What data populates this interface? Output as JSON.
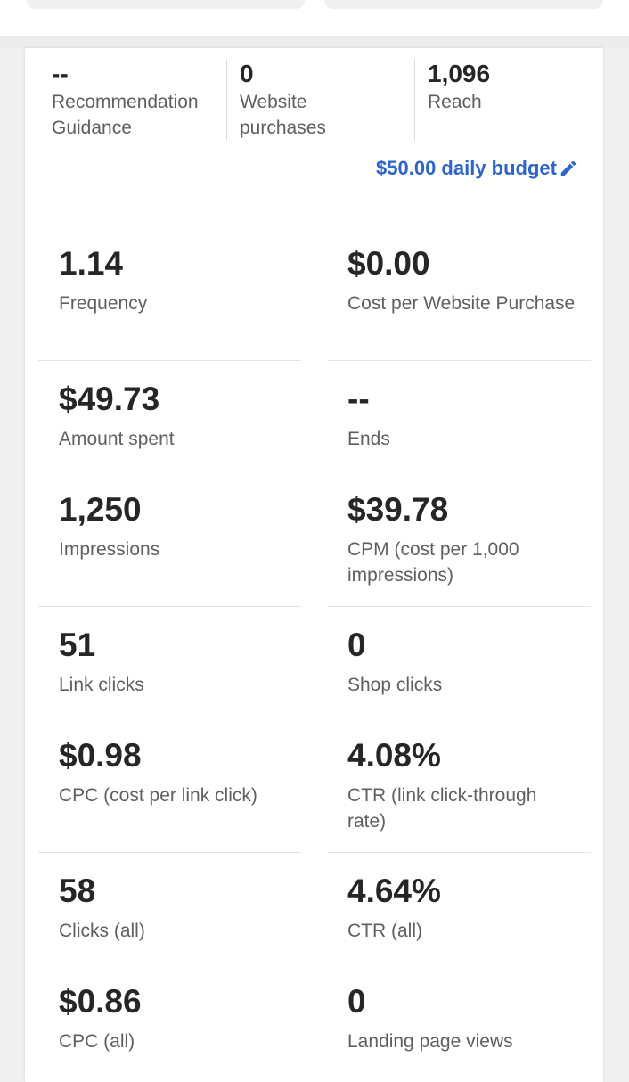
{
  "summary": [
    {
      "value": "--",
      "label": "Recommendation Guidance"
    },
    {
      "value": "0",
      "label": "Website purchases"
    },
    {
      "value": "1,096",
      "label": "Reach"
    }
  ],
  "budget": {
    "text": "$50.00 daily budget",
    "icon": "pencil-icon",
    "color": "#2d65c9"
  },
  "metrics": [
    {
      "left": {
        "value": "1.14",
        "label": "Frequency"
      },
      "right": {
        "value": "$0.00",
        "label": "Cost per Website Purchase"
      }
    },
    {
      "left": {
        "value": "$49.73",
        "label": "Amount spent"
      },
      "right": {
        "value": "--",
        "label": "Ends"
      }
    },
    {
      "left": {
        "value": "1,250",
        "label": "Impressions"
      },
      "right": {
        "value": "$39.78",
        "label": "CPM (cost per 1,000 impressions)"
      }
    },
    {
      "left": {
        "value": "51",
        "label": "Link clicks"
      },
      "right": {
        "value": "0",
        "label": "Shop clicks"
      }
    },
    {
      "left": {
        "value": "$0.98",
        "label": "CPC (cost per link click)"
      },
      "right": {
        "value": "4.08%",
        "label": "CTR (link click-through rate)"
      }
    },
    {
      "left": {
        "value": "58",
        "label": "Clicks (all)"
      },
      "right": {
        "value": "4.64%",
        "label": "CTR (all)"
      }
    },
    {
      "left": {
        "value": "$0.86",
        "label": "CPC (all)"
      },
      "right": {
        "value": "0",
        "label": "Landing page views"
      }
    }
  ]
}
